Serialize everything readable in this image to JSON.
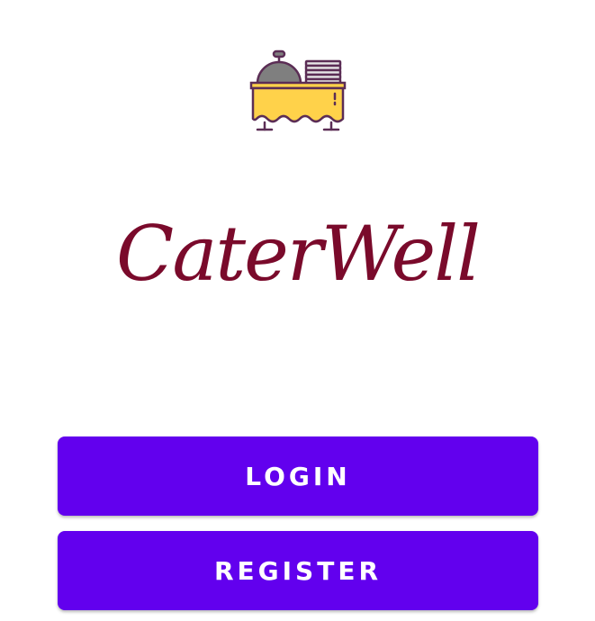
{
  "app": {
    "name": "CaterWell",
    "logo_icon": "catering-buffet-icon"
  },
  "actions": {
    "login_label": "LOGIN",
    "register_label": "REGISTER"
  },
  "colors": {
    "brand_title": "#7a0a2b",
    "button_bg": "#6200ee",
    "button_text": "#ffffff",
    "logo_outline": "#5b2d55",
    "logo_table": "#ffd24a",
    "logo_dome": "#7f7f7f"
  }
}
